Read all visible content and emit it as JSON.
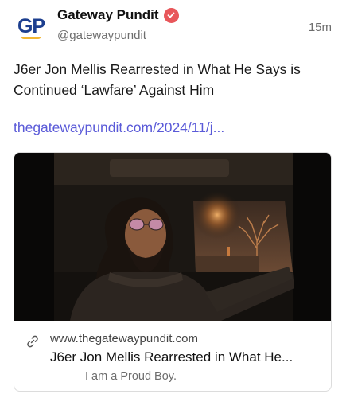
{
  "account": {
    "avatar_text": "GP",
    "display_name": "Gateway Pundit",
    "handle": "@gatewaypundit",
    "verified_icon": "verified-badge-icon",
    "verified_color": "#e8565a",
    "brand_color": "#1d3f8f"
  },
  "post": {
    "timestamp": "15m",
    "text": "J6er Jon Mellis Rearrested in What He Says is Continued ‘Lawfare’ Against Him",
    "link_text": "thegatewaypundit.com/2024/11/j...",
    "link_color": "#5a5ad8"
  },
  "link_card": {
    "icon": "link-icon",
    "domain": "www.thegatewaypundit.com",
    "title": "J6er Jon Mellis Rearrested in What He...",
    "description": "I am a Proud Boy.",
    "image_description_icon": "car-selfie-photo"
  }
}
